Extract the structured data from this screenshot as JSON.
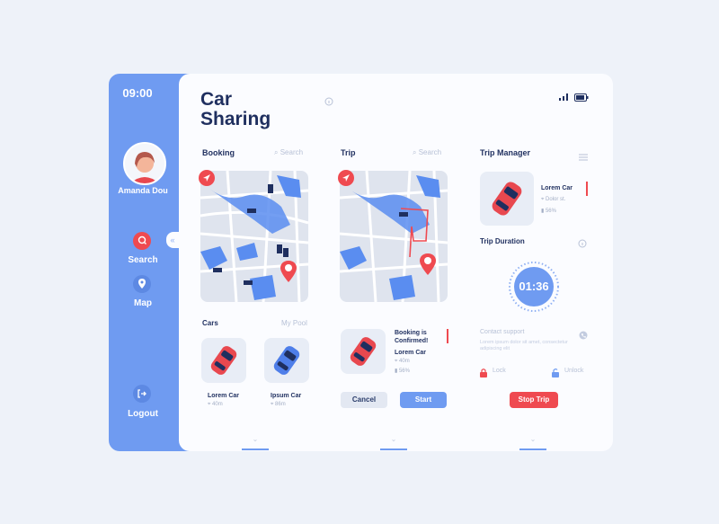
{
  "app": {
    "title_line1": "Car",
    "title_line2": "Sharing"
  },
  "sidebar": {
    "time": "09:00",
    "user_name": "Amanda Dou",
    "nav": [
      {
        "label": "Search",
        "icon": "search-icon"
      },
      {
        "label": "Map",
        "icon": "map-pin-icon"
      }
    ],
    "logout_label": "Logout"
  },
  "booking": {
    "title": "Booking",
    "search_placeholder": "Search",
    "cars_title": "Cars",
    "pool_link": "My Pool",
    "cars": [
      {
        "name": "Lorem Car",
        "distance": "40m",
        "color": "#e8484f"
      },
      {
        "name": "Ipsum Car",
        "distance": "86m",
        "color": "#4e7ee9"
      }
    ]
  },
  "trip": {
    "title": "Trip",
    "search_placeholder": "Search",
    "status": "Booking is Confirmed!",
    "car_name": "Lorem Car",
    "distance": "40m",
    "battery": "56%",
    "cancel_label": "Cancel",
    "start_label": "Start"
  },
  "manager": {
    "title": "Trip Manager",
    "car_name": "Lorem Car",
    "address": "Dolor st.",
    "battery": "56%",
    "duration_title": "Trip Duration",
    "duration": "01:36",
    "support_label": "Contact support",
    "support_text": "Lorem ipsum dolor sit amet, consectetur adipiscing elit",
    "lock_label": "Lock",
    "unlock_label": "Unlock",
    "stop_label": "Stop Trip"
  },
  "colors": {
    "accent": "#6f9bf1",
    "danger": "#ef4a50",
    "dark": "#1f2f5f"
  }
}
